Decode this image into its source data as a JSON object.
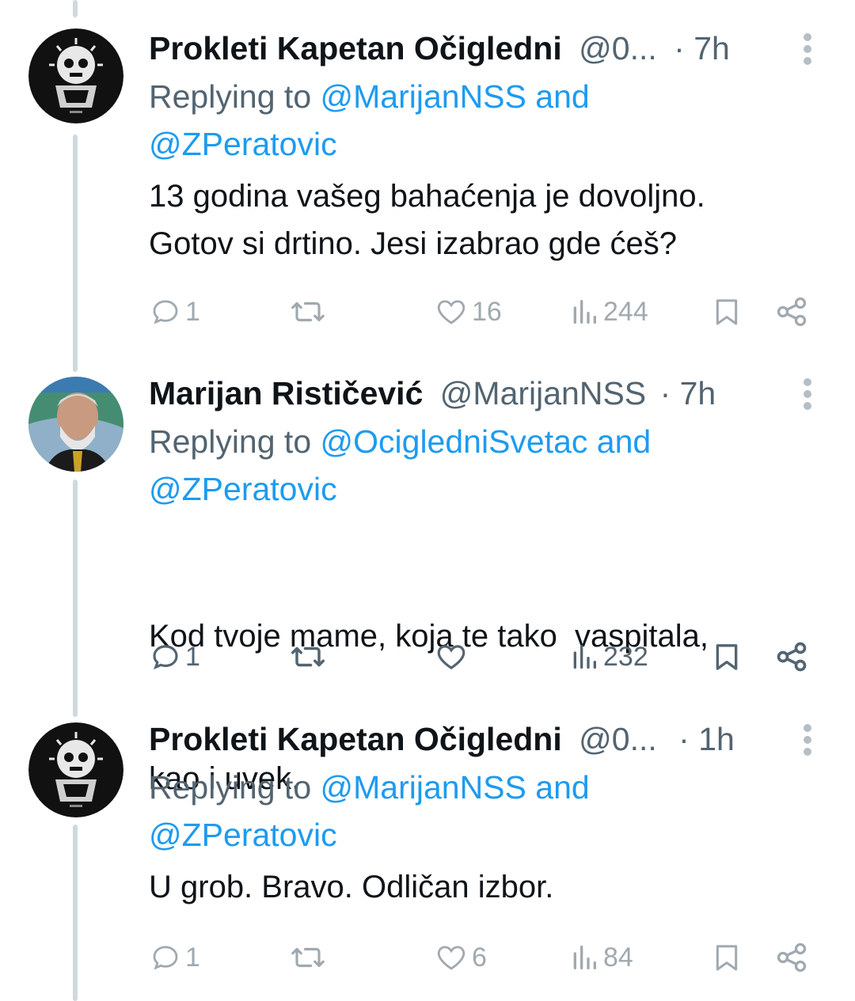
{
  "tweets": [
    {
      "name": "Prokleti Kapetan Očigledni",
      "handle": "@0...",
      "time": "7h",
      "replying_prefix": "Replying to ",
      "mention1": "@MarijanNSS and",
      "mention2": "@ZPeratovic",
      "text_line1": "13 godina vašeg bahaćenja je dovoljno.",
      "text_line2": "Gotov si drtino. Jesi izabrao gde ćeš?",
      "replies": "1",
      "likes": "16",
      "views": "244",
      "avatar": "skull-logo-avatar"
    },
    {
      "name": "Marijan Rističević",
      "handle": "@MarijanNSS",
      "time": "7h",
      "replying_prefix": "Replying to ",
      "mention1": "@OcigledniSvetac and",
      "mention2": "@ZPeratovic",
      "text_line1": "Kod tvoje mame, koja te tako  vaspitala,",
      "text_line2": "kao i uvek.",
      "replies": "1",
      "likes": "",
      "views": "232",
      "avatar": "bearded-man-photo-avatar"
    },
    {
      "name": "Prokleti Kapetan Očigledni",
      "handle": "@0...",
      "time": "1h",
      "replying_prefix": "Replying to ",
      "mention1": "@MarijanNSS and",
      "mention2": "@ZPeratovic",
      "text_line1": "U grob. Bravo. Odličan izbor.",
      "text_line2": "",
      "replies": "1",
      "likes": "6",
      "views": "84",
      "avatar": "skull-logo-avatar"
    }
  ],
  "colors": {
    "link": "#1d9bf0",
    "muted": "#536471",
    "text": "#0f1419",
    "thread_line": "#cfd9de"
  }
}
